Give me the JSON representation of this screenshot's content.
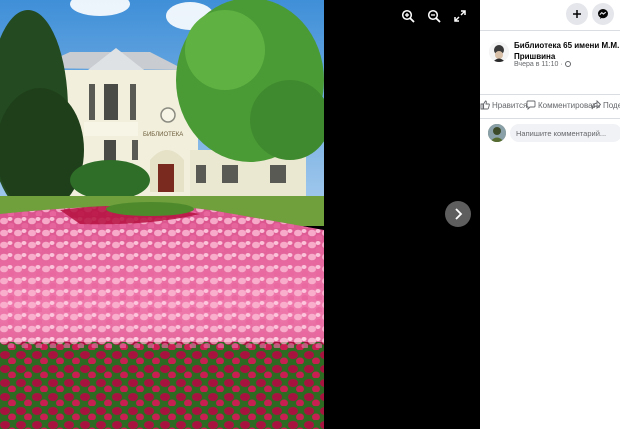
{
  "viewer": {
    "zoom_in_icon": "zoom-in-icon",
    "zoom_out_icon": "zoom-out-icon",
    "fullscreen_icon": "expand-icon",
    "next_icon": "chevron-right-icon"
  },
  "header": {
    "create_icon": "plus-icon",
    "messenger_icon": "messenger-icon"
  },
  "post": {
    "author": "Библиотека 65 имени М.М. Пришвина",
    "time": "Вчера в 11:10 ·",
    "building_sign": "БИБЛИОТЕКА"
  },
  "actions": {
    "like": "Нравится",
    "comment": "Комментировать",
    "share": "Поделиться"
  },
  "comment": {
    "placeholder": "Напишите комментарий..."
  },
  "colors": {
    "accent": "#1877f2",
    "secondary_text": "#65676b",
    "input_bg": "#f0f2f5"
  }
}
